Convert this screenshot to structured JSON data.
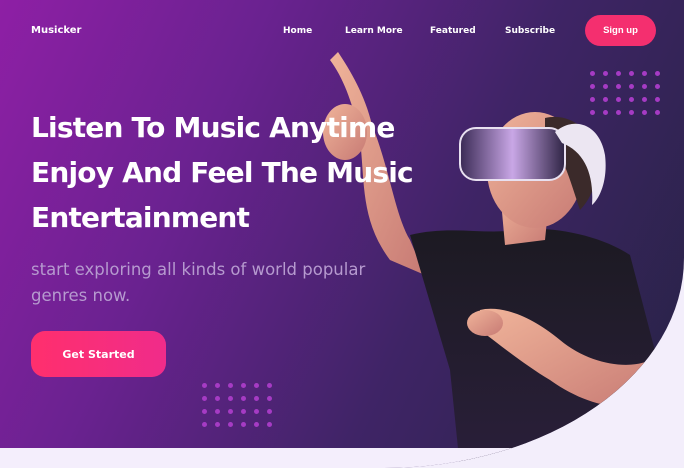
{
  "header": {
    "brand": "Musicker",
    "nav": [
      "Home",
      "Learn More",
      "Featured",
      "Subscribe"
    ],
    "signup_label": "Sign up"
  },
  "hero": {
    "headline_lines": [
      "Listen To Music Anytime",
      "Enjoy And Feel The Music",
      "Entertainment"
    ],
    "subtext": "start exploring all kinds of world popular genres now.",
    "cta_label": "Get Started"
  },
  "colors": {
    "accent": "#f42f6f",
    "background_start": "#8e1fa5",
    "background_end": "#262344"
  }
}
